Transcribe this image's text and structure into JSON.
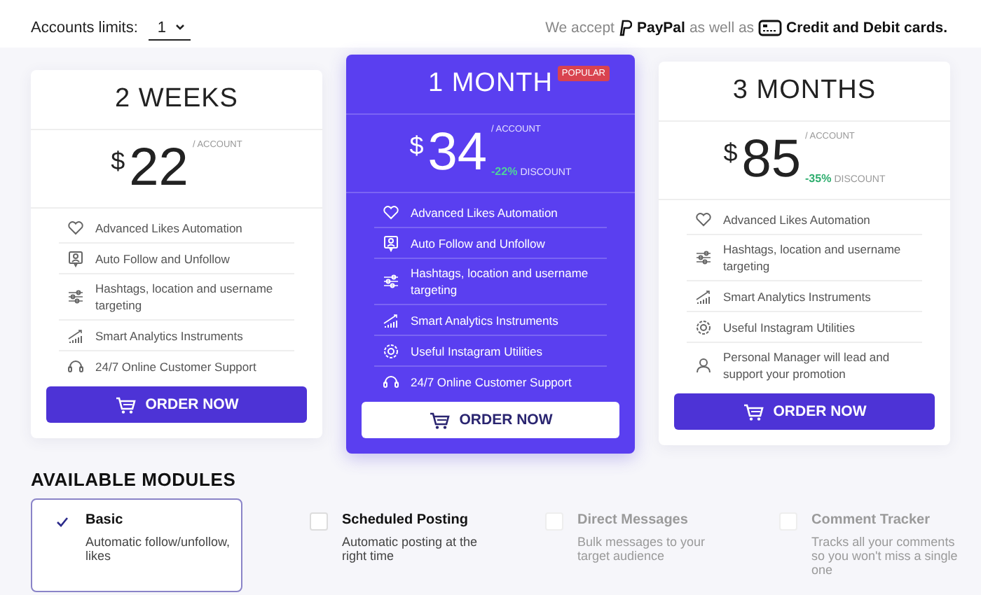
{
  "accounts_limit": {
    "label": "Accounts limits:",
    "value": "1"
  },
  "payment": [
    {
      "kind": "text",
      "text": "We accept"
    },
    {
      "kind": "paypal",
      "text": "PayPal"
    },
    {
      "kind": "text",
      "text": "as well as"
    },
    {
      "kind": "card",
      "text": "Credit and Debit cards."
    }
  ],
  "plans": [
    {
      "title": "2 WEEKS",
      "highlighted": false,
      "currency": "$",
      "amount": "22",
      "per": "/ ACCOUNT",
      "features": [
        {
          "kind": "heart",
          "text": "Advanced Likes Automation"
        },
        {
          "kind": "person",
          "text": "Auto Follow and Unfollow"
        },
        {
          "kind": "sliders",
          "text": "Hashtags, location and username targeting"
        },
        {
          "kind": "chart",
          "text": "Smart Analytics Instruments"
        },
        {
          "kind": "headset",
          "text": "24/7 Online Customer Support"
        }
      ],
      "button": "ORDER NOW"
    },
    {
      "title": "1 MONTH",
      "badge": "POPULAR",
      "highlighted": true,
      "currency": "$",
      "amount": "34",
      "per": "/ ACCOUNT",
      "discount": "-22%",
      "discount_label": "DISCOUNT",
      "features": [
        {
          "kind": "heart",
          "text": "Advanced Likes Automation"
        },
        {
          "kind": "person",
          "text": "Auto Follow and Unfollow"
        },
        {
          "kind": "sliders",
          "text": "Hashtags, location and username targeting"
        },
        {
          "kind": "chart",
          "text": "Smart Analytics Instruments"
        },
        {
          "kind": "gear",
          "text": "Useful Instagram Utilities"
        },
        {
          "kind": "headset",
          "text": "24/7 Online Customer Support"
        }
      ],
      "button": "ORDER NOW"
    },
    {
      "title": "3 MONTHS",
      "highlighted": false,
      "currency": "$",
      "amount": "85",
      "per": "/ ACCOUNT",
      "discount": "-35%",
      "discount_label": "DISCOUNT",
      "features": [
        {
          "kind": "heart",
          "text": "Advanced Likes Automation"
        },
        {
          "kind": "sliders",
          "text": "Hashtags, location and username targeting"
        },
        {
          "kind": "chart",
          "text": "Smart Analytics Instruments"
        },
        {
          "kind": "gear",
          "text": "Useful Instagram Utilities"
        },
        {
          "kind": "manager",
          "text": "Personal Manager will lead and support your promotion"
        }
      ],
      "button": "ORDER NOW"
    }
  ],
  "modules_title": "AVAILABLE MODULES",
  "modules": [
    {
      "name": "Basic",
      "description": "Automatic follow/unfollow, likes",
      "checked": true,
      "selected": true,
      "disabled": false
    },
    {
      "name": "Scheduled Posting",
      "description": "Automatic posting at the right time",
      "checked": false,
      "selected": false,
      "disabled": false
    },
    {
      "name": "Direct Messages",
      "description": "Bulk messages to your target audience",
      "checked": false,
      "selected": false,
      "disabled": true
    },
    {
      "name": "Comment Tracker",
      "description": "Tracks all your comments so you won't miss a single one",
      "checked": false,
      "selected": false,
      "disabled": true
    }
  ]
}
